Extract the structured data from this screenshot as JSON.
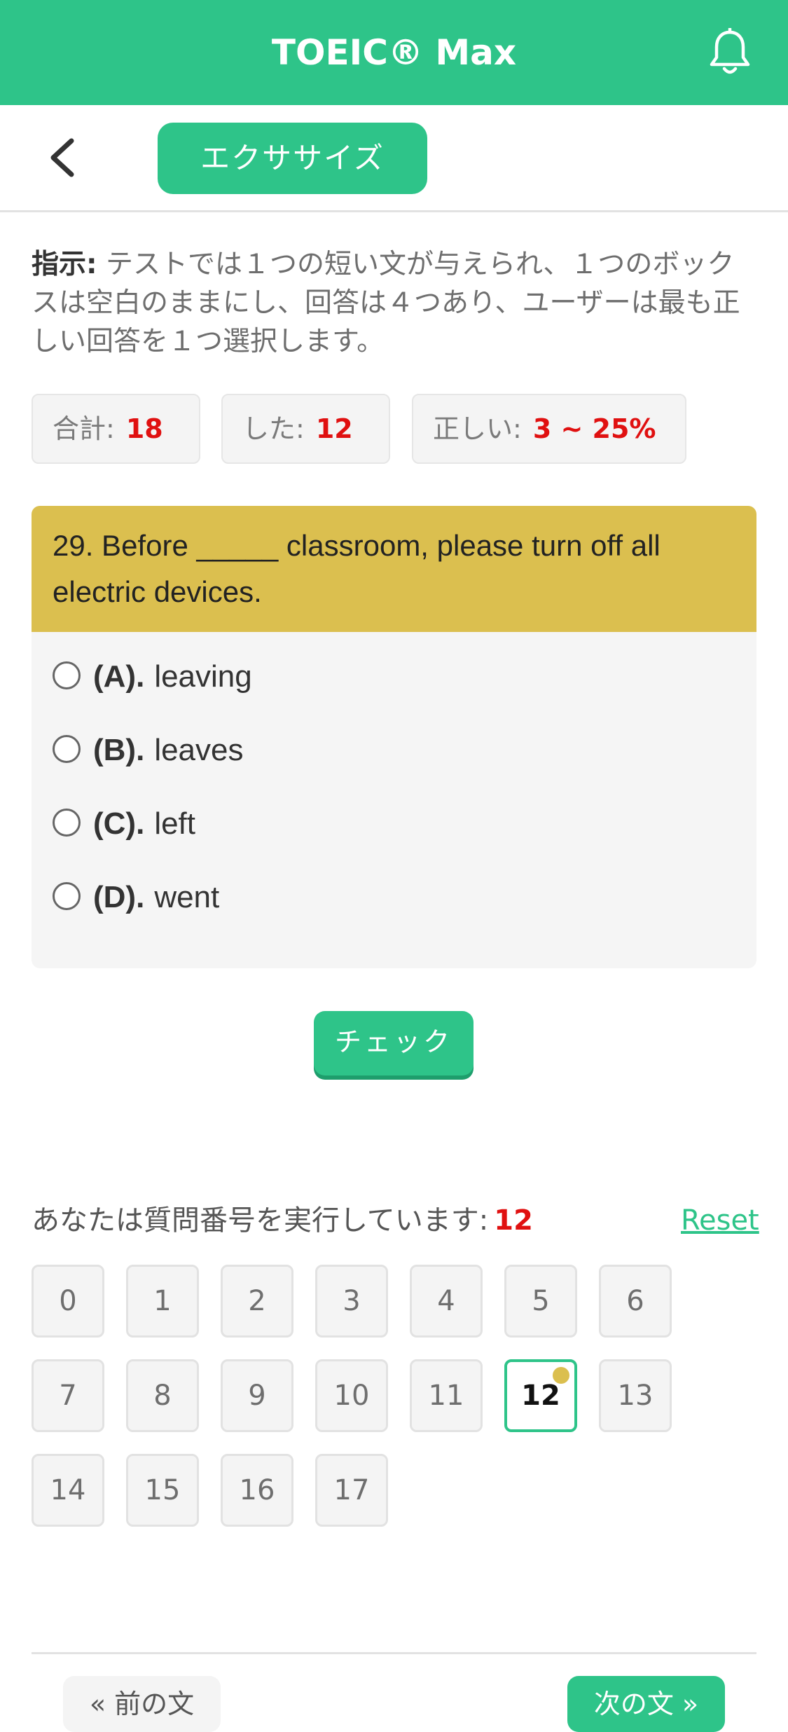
{
  "header": {
    "title": "TOEIC® Max",
    "bell_icon": "bell-icon"
  },
  "subbar": {
    "back_icon": "chevron-left-icon",
    "tab_label": "エクササイズ"
  },
  "instructions": {
    "label": "指示:",
    "text": " テストでは１つの短い文が与えられ、１つのボックスは空白のままにし、回答は４つあり、ユーザーは最も正しい回答を１つ選択します。"
  },
  "stats": [
    {
      "label": "合計:",
      "value": "18"
    },
    {
      "label": "した:",
      "value": "12"
    },
    {
      "label": "正しい:",
      "value": "3 ~ 25%"
    }
  ],
  "question": {
    "text": "29. Before _____ classroom, please turn off all electric devices.",
    "options": [
      {
        "letter": "(A).",
        "text": "leaving"
      },
      {
        "letter": "(B).",
        "text": "leaves"
      },
      {
        "letter": "(C).",
        "text": "left"
      },
      {
        "letter": "(D).",
        "text": "went"
      }
    ]
  },
  "check_label": "チェック",
  "progress": {
    "label": "あなたは質問番号を実行しています:",
    "current": "12",
    "reset_label": "Reset"
  },
  "question_numbers": [
    "0",
    "1",
    "2",
    "3",
    "4",
    "5",
    "6",
    "7",
    "8",
    "9",
    "10",
    "11",
    "12",
    "13",
    "14",
    "15",
    "16",
    "17"
  ],
  "nav": {
    "prev_label": "« 前の文",
    "next_label": "次の文 »"
  },
  "colors": {
    "brand": "#2ec489",
    "question_header": "#dbbf4f",
    "highlight": "#e01010"
  }
}
